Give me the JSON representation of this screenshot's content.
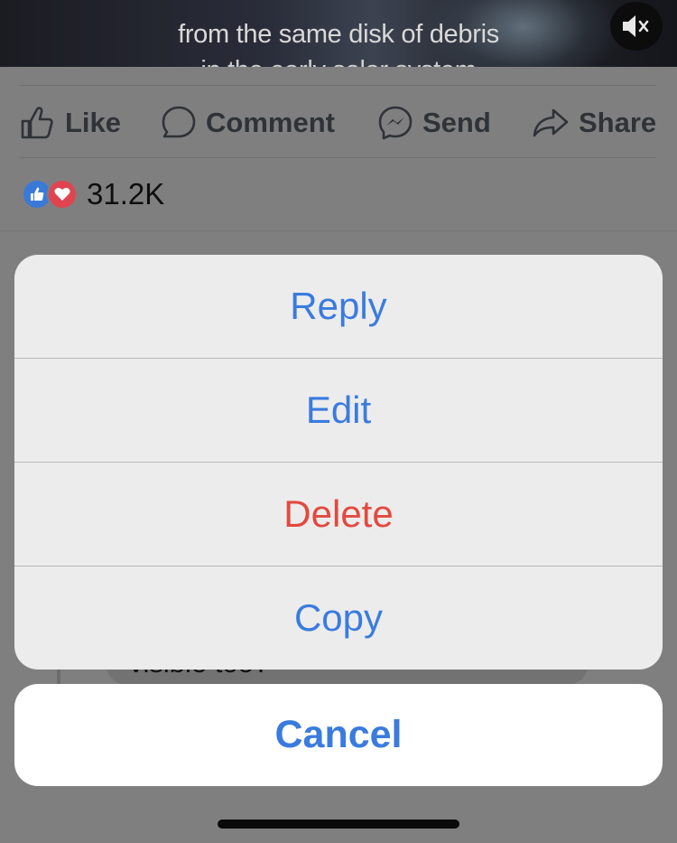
{
  "video": {
    "caption": "from the same disk of debris",
    "caption_next_line": "in the early solar system",
    "mute_icon": "speaker-muted-icon"
  },
  "post_actions": [
    {
      "label": "Like",
      "icon": "thumbs-up-icon"
    },
    {
      "label": "Comment",
      "icon": "comment-bubble-icon"
    },
    {
      "label": "Send",
      "icon": "messenger-icon"
    },
    {
      "label": "Share",
      "icon": "share-arrow-icon"
    }
  ],
  "reactions": {
    "icons": [
      "like-reaction-icon",
      "love-reaction-icon"
    ],
    "count": "31.2K",
    "colors": {
      "like": "#3b79d8",
      "love": "#e0454f"
    }
  },
  "comment_preview": {
    "text": "visible too?"
  },
  "action_sheet": {
    "items": [
      {
        "label": "Reply",
        "style": "default"
      },
      {
        "label": "Edit",
        "style": "default"
      },
      {
        "label": "Delete",
        "style": "destructive"
      },
      {
        "label": "Copy",
        "style": "default"
      }
    ],
    "cancel_label": "Cancel",
    "colors": {
      "accent": "#3a7bdf",
      "destructive": "#e2493f"
    }
  }
}
